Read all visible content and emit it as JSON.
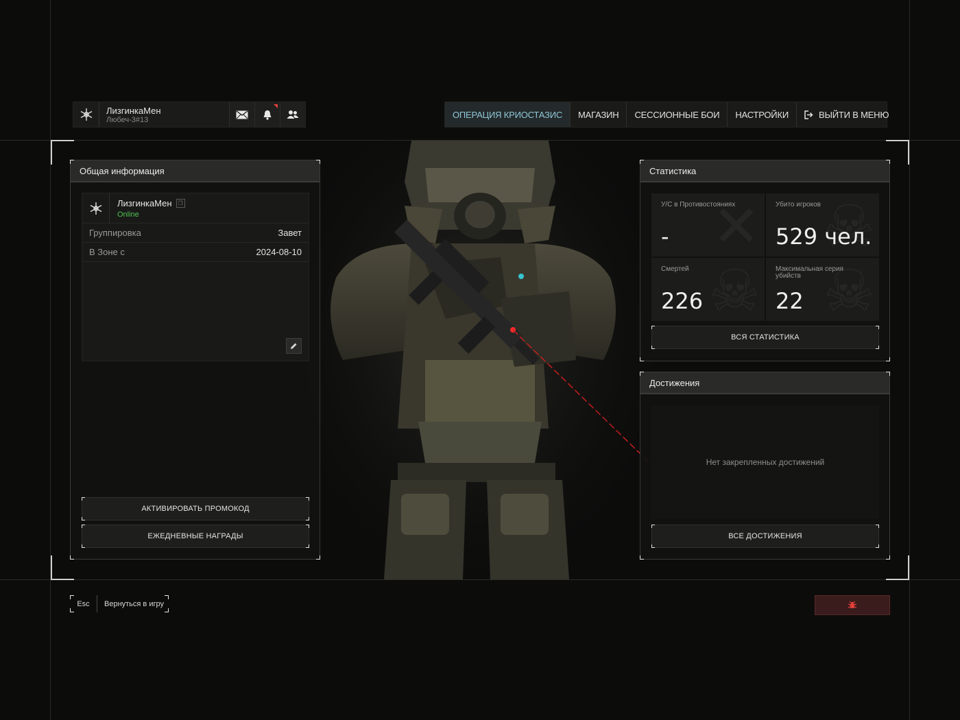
{
  "profile": {
    "name": "ЛизгинкаМен",
    "tag": "Любеч-3#13",
    "icons": [
      "emblem-icon",
      "mail-icon",
      "bell-icon",
      "friends-icon"
    ]
  },
  "nav": {
    "items": [
      {
        "label": "ОПЕРАЦИЯ КРИОСТАЗИС",
        "active": true
      },
      {
        "label": "МАГАЗИН",
        "active": false
      },
      {
        "label": "СЕССИОННЫЕ БОИ",
        "active": false
      },
      {
        "label": "НАСТРОЙКИ",
        "active": false
      },
      {
        "label": "ВЫЙТИ В МЕНЮ",
        "active": false
      }
    ]
  },
  "general": {
    "title": "Общая информация",
    "name": "ЛизгинкаМен",
    "status": "Online",
    "rows": [
      {
        "key": "Группировка",
        "value": "Завет"
      },
      {
        "key": "В Зоне с",
        "value": "2024-08-10"
      }
    ],
    "promo_button": "АКТИВИРОВАТЬ ПРОМОКОД",
    "daily_button": "ЕЖЕДНЕВНЫЕ НАГРАДЫ"
  },
  "stats": {
    "title": "Статистика",
    "cells": [
      {
        "label": "У/С в Противостояниях",
        "value": "-"
      },
      {
        "label": "Убито игроков",
        "value": "529 чел."
      },
      {
        "label": "Смертей",
        "value": "226"
      },
      {
        "label": "Максимальная серия убийств",
        "value": "22"
      }
    ],
    "all_button": "ВСЯ СТАТИСТИКА"
  },
  "achievements": {
    "title": "Достижения",
    "empty_text": "Нет закрепленных достижений",
    "all_button": "ВСЕ ДОСТИЖЕНИЯ"
  },
  "footer": {
    "esc_key": "Esc",
    "esc_label": "Вернуться в игру"
  },
  "colors": {
    "accent": "#8fc7d6",
    "online": "#4fc24f",
    "danger": "#e0403a"
  }
}
